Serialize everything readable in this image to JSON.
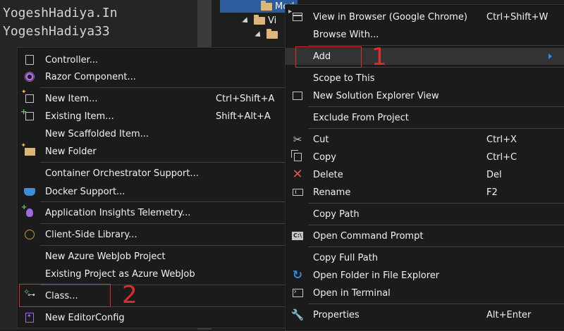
{
  "watermark": {
    "line1": "YogeshHadiya.In",
    "line2": "YogeshHadiya33"
  },
  "tree": {
    "item1": "Mod",
    "item2": "Vi"
  },
  "left_menu": {
    "items": [
      {
        "label": "Controller...",
        "shortcut": "",
        "icon": "controller-icon"
      },
      {
        "label": "Razor Component...",
        "shortcut": "",
        "icon": "razor-component-icon"
      },
      {
        "label": "New Item...",
        "shortcut": "Ctrl+Shift+A",
        "icon": "new-item-icon"
      },
      {
        "label": "Existing Item...",
        "shortcut": "Shift+Alt+A",
        "icon": "existing-item-icon"
      },
      {
        "label": "New Scaffolded Item...",
        "shortcut": "",
        "icon": ""
      },
      {
        "label": "New Folder",
        "shortcut": "",
        "icon": "new-folder-icon"
      },
      {
        "label": "Container Orchestrator Support...",
        "shortcut": "",
        "icon": ""
      },
      {
        "label": "Docker Support...",
        "shortcut": "",
        "icon": "docker-icon"
      },
      {
        "label": "Application Insights Telemetry...",
        "shortcut": "",
        "icon": "insights-icon"
      },
      {
        "label": "Client-Side Library...",
        "shortcut": "",
        "icon": "client-library-icon"
      },
      {
        "label": "New Azure WebJob Project",
        "shortcut": "",
        "icon": ""
      },
      {
        "label": "Existing Project as Azure WebJob",
        "shortcut": "",
        "icon": ""
      },
      {
        "label": "Class...",
        "shortcut": "",
        "icon": "class-icon"
      },
      {
        "label": "New EditorConfig",
        "shortcut": "",
        "icon": "editorconfig-icon"
      }
    ]
  },
  "right_menu": {
    "items": [
      {
        "label": "View in Browser (Google Chrome)",
        "shortcut": "Ctrl+Shift+W",
        "icon": "browser-icon"
      },
      {
        "label": "Browse With...",
        "shortcut": "",
        "icon": ""
      },
      {
        "label": "Add",
        "shortcut": "",
        "icon": ""
      },
      {
        "label": "Scope to This",
        "shortcut": "",
        "icon": ""
      },
      {
        "label": "New Solution Explorer View",
        "shortcut": "",
        "icon": "solution-explorer-icon"
      },
      {
        "label": "Exclude From Project",
        "shortcut": "",
        "icon": ""
      },
      {
        "label": "Cut",
        "shortcut": "Ctrl+X",
        "icon": "cut-icon"
      },
      {
        "label": "Copy",
        "shortcut": "Ctrl+C",
        "icon": "copy-icon"
      },
      {
        "label": "Delete",
        "shortcut": "Del",
        "icon": "delete-icon"
      },
      {
        "label": "Rename",
        "shortcut": "F2",
        "icon": "rename-icon"
      },
      {
        "label": "Copy Path",
        "shortcut": "",
        "icon": ""
      },
      {
        "label": "Open Command Prompt",
        "shortcut": "",
        "icon": "command-prompt-icon"
      },
      {
        "label": "Copy Full Path",
        "shortcut": "",
        "icon": ""
      },
      {
        "label": "Open Folder in File Explorer",
        "shortcut": "",
        "icon": "open-folder-icon"
      },
      {
        "label": "Open in Terminal",
        "shortcut": "",
        "icon": "terminal-icon"
      },
      {
        "label": "Properties",
        "shortcut": "Alt+Enter",
        "icon": "wrench-icon"
      }
    ]
  },
  "annotations": {
    "step1": "1",
    "step2": "2",
    "color": "#e02b2b"
  },
  "colors": {
    "menu_bg": "#1b1b1c",
    "highlight": "#333334",
    "selection": "#2c5c9c",
    "accent": "#1e90ff"
  }
}
